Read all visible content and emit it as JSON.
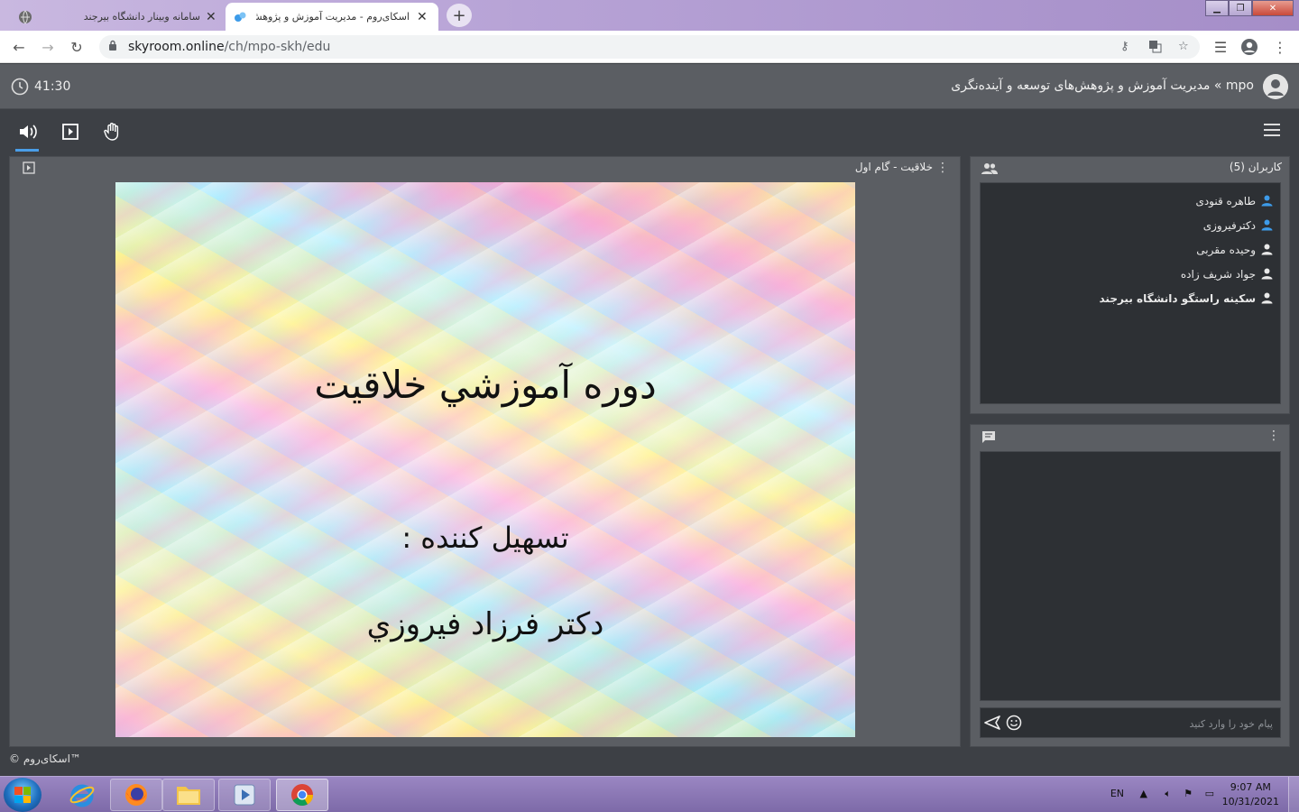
{
  "browser": {
    "tabs": [
      {
        "title": "سامانه وبینار دانشگاه بیرجند",
        "active": false
      },
      {
        "title": "اسکای‌روم - مدیریت آموزش و پژوهش‌های",
        "active": true
      }
    ],
    "url_host": "skyroom.online",
    "url_path": "/ch/mpo-skh/edu"
  },
  "header": {
    "timer": "41:30",
    "room_title": "mpo » مدیریت آموزش و پژوهش‌های توسعه و آینده‌نگری"
  },
  "presentation": {
    "title": "خلاقیت - گام اول",
    "slide_title": "دوره آموزشي خلاقيت",
    "slide_subtitle": "تسهيل كننده :",
    "slide_presenter": "دكتر فرزاد فيروزي"
  },
  "users": {
    "label": "کاربران (5)",
    "list": [
      {
        "name": "طاهره قنودی",
        "color": "#3d9be9",
        "bold": false
      },
      {
        "name": "دکترفیروزی",
        "color": "#3d9be9",
        "bold": false
      },
      {
        "name": "وحیده مقربی",
        "color": "#e9e9e9",
        "bold": false
      },
      {
        "name": "جواد شریف زاده",
        "color": "#e9e9e9",
        "bold": false
      },
      {
        "name": "سکینه راستگو دانشگاه بیرجند",
        "color": "#e9e9e9",
        "bold": true
      }
    ]
  },
  "chat": {
    "placeholder": "پیام خود را وارد کنید"
  },
  "footer": "© اسکای‌روم™",
  "taskbar": {
    "language": "EN",
    "time": "9:07 AM",
    "date": "10/31/2021"
  },
  "colors": {
    "accent": "#4a9ee8",
    "panel": "#5b5e63",
    "panel_dark": "#2d3034",
    "background": "#3d4045"
  }
}
